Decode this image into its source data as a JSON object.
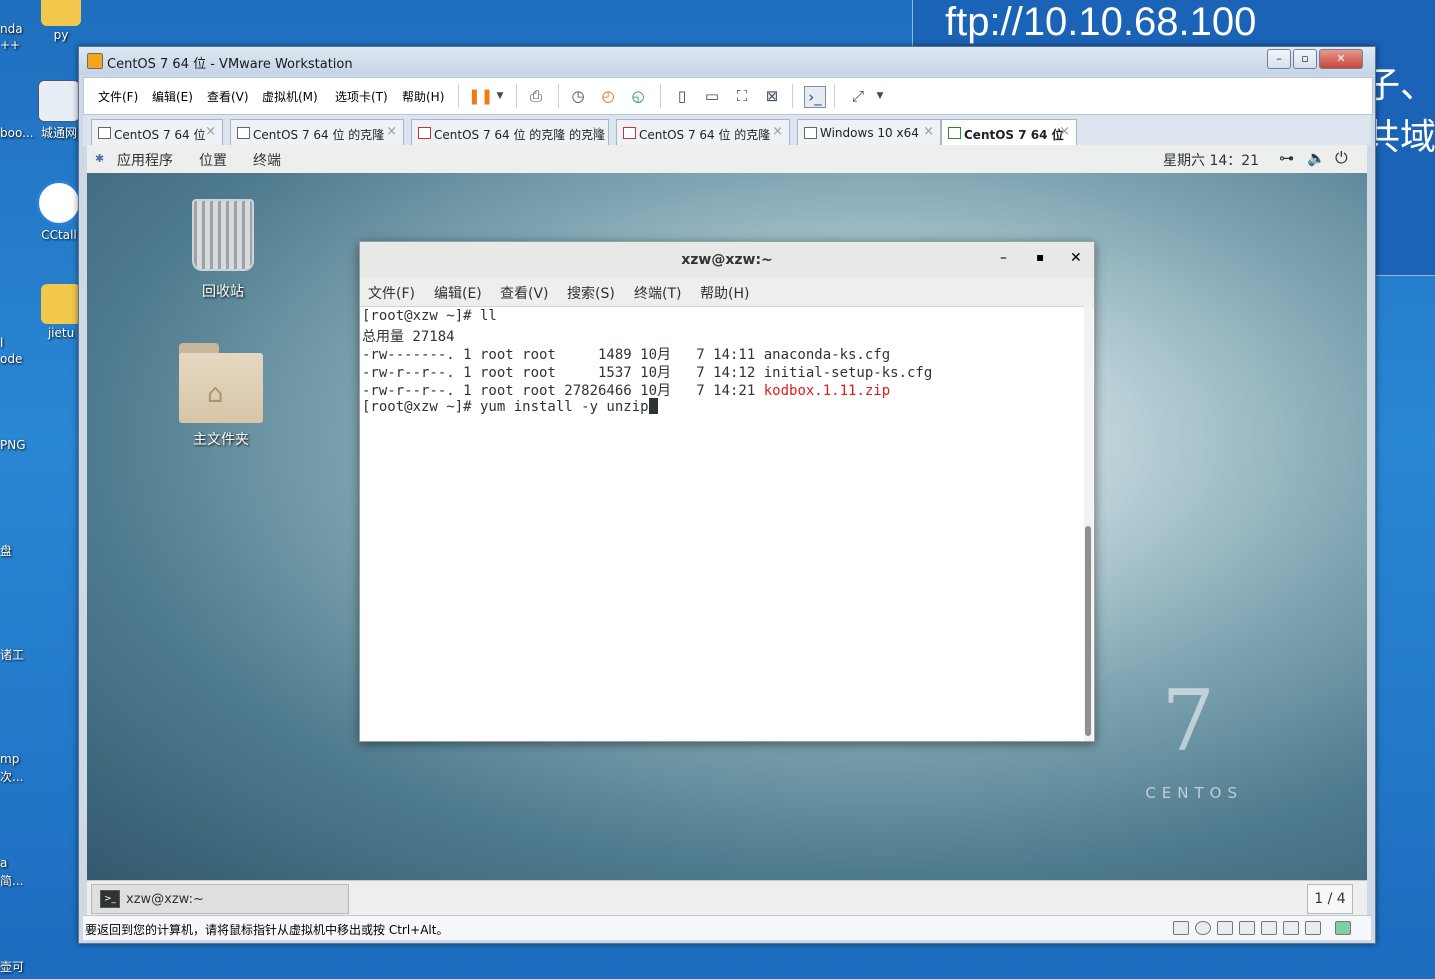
{
  "host": {
    "banner_ftp": "ftp://10.10.68.100",
    "banner_side_1": "荷子、",
    "banner_side_2": "公共域",
    "desktop_icons": [
      {
        "label": "py"
      },
      {
        "label": "城通网"
      },
      {
        "label": "CCtall"
      },
      {
        "label": "jietu"
      }
    ],
    "edge_labels": [
      "nda",
      "++",
      "boo...",
      "l",
      "ode",
      "PNG",
      "盘",
      "诸工",
      "mp",
      "次...",
      "a",
      "简...",
      "壶可"
    ]
  },
  "vmware": {
    "title": "CentOS 7 64 位 - VMware Workstation",
    "win_buttons": {
      "minimize": "–",
      "restore": "▫",
      "close": "✕"
    },
    "menu": [
      "文件(F)",
      "编辑(E)",
      "查看(V)",
      "虚拟机(M)",
      "选项卡(T)",
      "帮助(H)"
    ],
    "toolbar_icons": [
      "pause-icon",
      "dropdown-icon",
      "send-ctrl-alt-del-icon",
      "snapshot-icon",
      "revert-snapshot-icon",
      "snapshot-manager-icon",
      "sidebar-view-icon",
      "thumbnail-view-icon",
      "fullscreen-icon",
      "unity-icon",
      "console-view-icon",
      "stretch-icon"
    ],
    "tabs": [
      {
        "label": "CentOS 7 64 位",
        "close": "×",
        "active": false
      },
      {
        "label": "CentOS 7 64 位 的克隆",
        "close": "×",
        "active": false
      },
      {
        "label": "CentOS 7 64 位 的克隆 的克隆",
        "close": "×",
        "active": false
      },
      {
        "label": "CentOS 7 64 位 的克隆",
        "close": "×",
        "active": false
      },
      {
        "label": "Windows 10 x64",
        "close": "×",
        "active": false
      },
      {
        "label": "CentOS 7 64 位",
        "close": "×",
        "active": true
      }
    ],
    "status_text": "要返回到您的计算机，请将鼠标指针从虚拟机中移出或按 Ctrl+Alt。"
  },
  "guest": {
    "topbar": {
      "apps": "应用程序",
      "places": "位置",
      "terminal": "终端",
      "clock": "星期六 14：21"
    },
    "desktop": {
      "trash_label": "回收站",
      "home_label": "主文件夹",
      "logo_digit": "7",
      "logo_text": "CENTOS"
    },
    "terminal": {
      "title": "xzw@xzw:~",
      "win_buttons": {
        "minimize": "–",
        "maximize": "▪",
        "close": "✕"
      },
      "menu": [
        "文件(F)",
        "编辑(E)",
        "查看(V)",
        "搜索(S)",
        "终端(T)",
        "帮助(H)"
      ],
      "lines": [
        "[root@xzw ~]# ll",
        "总用量 27184",
        "-rw-------. 1 root root     1489 10月   7 14:11 anaconda-ks.cfg",
        "-rw-r--r--. 1 root root     1537 10月   7 14:12 initial-setup-ks.cfg",
        "-rw-r--r--. 1 root root 27826466 10月   7 14:21 "
      ],
      "red_file": "kodbox.1.11.zip",
      "prompt_line": "[root@xzw ~]# yum install -y unzip"
    },
    "taskbar": {
      "window_label": "xzw@xzw:~",
      "pager": "1 / 4"
    }
  }
}
